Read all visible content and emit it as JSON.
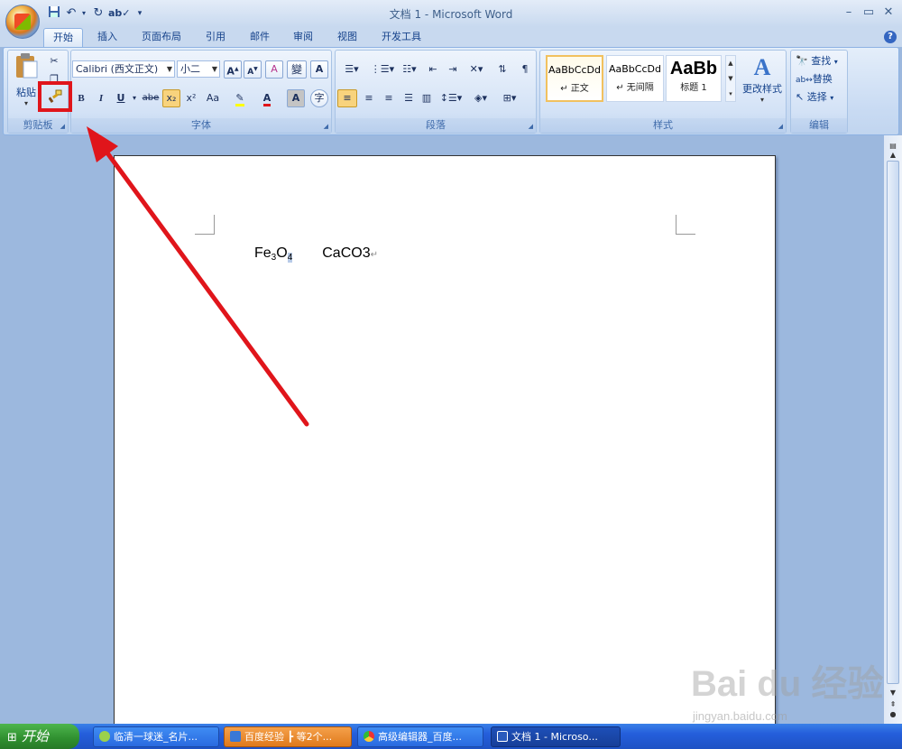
{
  "window": {
    "title": "文档 1 - Microsoft Word",
    "controls": {
      "minimize": "–",
      "maximize": "▭",
      "close": "✕"
    }
  },
  "quick_access": {
    "save_icon": "save-icon",
    "undo_icon": "undo-icon",
    "redo_icon": "redo-icon",
    "spell_icon": "abc-check-icon",
    "customize_icon": "chevron-down-icon"
  },
  "tabs": [
    {
      "label": "开始",
      "active": true
    },
    {
      "label": "插入",
      "active": false
    },
    {
      "label": "页面布局",
      "active": false
    },
    {
      "label": "引用",
      "active": false
    },
    {
      "label": "邮件",
      "active": false
    },
    {
      "label": "审阅",
      "active": false
    },
    {
      "label": "视图",
      "active": false
    },
    {
      "label": "开发工具",
      "active": false
    }
  ],
  "help_label": "?",
  "ribbon": {
    "clipboard": {
      "label": "剪贴板",
      "paste_label": "粘贴"
    },
    "font": {
      "label": "字体",
      "font_name": "Calibri (西文正文)",
      "font_size": "小二",
      "bold": "B",
      "italic": "I",
      "underline": "U",
      "strike": "abe",
      "subscript": "x₂",
      "superscript": "x²",
      "change_case": "Aa",
      "grow": "A",
      "shrink": "A",
      "clear": "A",
      "char_border": "A",
      "phonetic": "變"
    },
    "paragraph": {
      "label": "段落"
    },
    "styles": {
      "label": "样式",
      "items": [
        {
          "preview": "AaBbCcDd",
          "name": "↵ 正文"
        },
        {
          "preview": "AaBbCcDd",
          "name": "↵ 无间隔"
        },
        {
          "preview": "AaBb",
          "name": "标题 1"
        }
      ],
      "change_styles": "更改样式"
    },
    "editing": {
      "label": "编辑",
      "find": "查找",
      "replace": "替换",
      "select": "选择"
    }
  },
  "document": {
    "formula1_main": "Fe",
    "formula1_sub1": "3",
    "formula1_o": "O",
    "formula1_sub2": "4",
    "formula2": "CaCO3",
    "paragraph_mark": "↵"
  },
  "taskbar": {
    "start_label": "开始",
    "items": [
      {
        "label": "临清一球迷_名片..."
      },
      {
        "label": "百度经验 ┣ 等2个..."
      },
      {
        "label": "高级编辑器_百度..."
      },
      {
        "label": "文档 1 - Microso..."
      }
    ]
  },
  "watermark": {
    "main": "Bai du 经验",
    "sub": "jingyan.baidu.com"
  },
  "colors": {
    "annotation": "#e0151b",
    "ribbon": "#c9dbf3",
    "taskbar": "#245edb"
  }
}
